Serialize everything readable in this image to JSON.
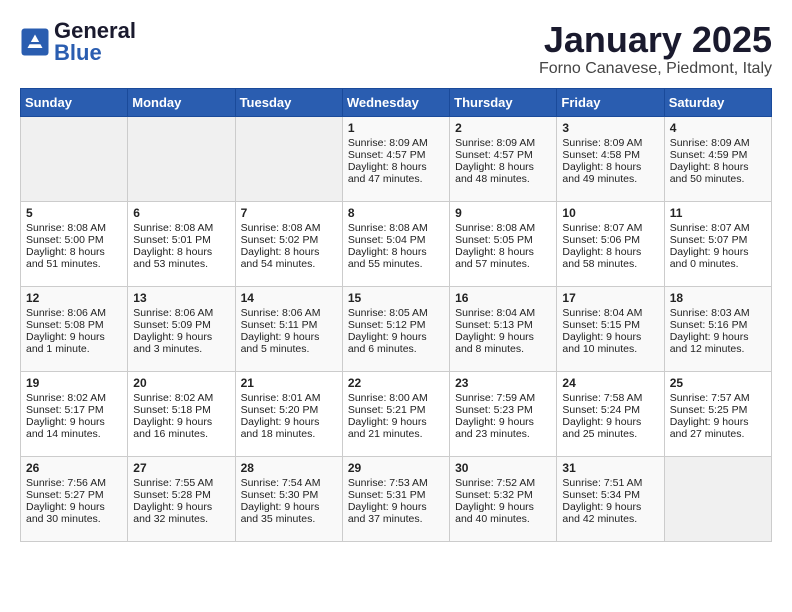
{
  "header": {
    "logo_text_general": "General",
    "logo_text_blue": "Blue",
    "title": "January 2025",
    "subtitle": "Forno Canavese, Piedmont, Italy"
  },
  "days_of_week": [
    "Sunday",
    "Monday",
    "Tuesday",
    "Wednesday",
    "Thursday",
    "Friday",
    "Saturday"
  ],
  "weeks": [
    [
      {
        "day": "",
        "info": ""
      },
      {
        "day": "",
        "info": ""
      },
      {
        "day": "",
        "info": ""
      },
      {
        "day": "1",
        "info": "Sunrise: 8:09 AM\nSunset: 4:57 PM\nDaylight: 8 hours and 47 minutes."
      },
      {
        "day": "2",
        "info": "Sunrise: 8:09 AM\nSunset: 4:57 PM\nDaylight: 8 hours and 48 minutes."
      },
      {
        "day": "3",
        "info": "Sunrise: 8:09 AM\nSunset: 4:58 PM\nDaylight: 8 hours and 49 minutes."
      },
      {
        "day": "4",
        "info": "Sunrise: 8:09 AM\nSunset: 4:59 PM\nDaylight: 8 hours and 50 minutes."
      }
    ],
    [
      {
        "day": "5",
        "info": "Sunrise: 8:08 AM\nSunset: 5:00 PM\nDaylight: 8 hours and 51 minutes."
      },
      {
        "day": "6",
        "info": "Sunrise: 8:08 AM\nSunset: 5:01 PM\nDaylight: 8 hours and 53 minutes."
      },
      {
        "day": "7",
        "info": "Sunrise: 8:08 AM\nSunset: 5:02 PM\nDaylight: 8 hours and 54 minutes."
      },
      {
        "day": "8",
        "info": "Sunrise: 8:08 AM\nSunset: 5:04 PM\nDaylight: 8 hours and 55 minutes."
      },
      {
        "day": "9",
        "info": "Sunrise: 8:08 AM\nSunset: 5:05 PM\nDaylight: 8 hours and 57 minutes."
      },
      {
        "day": "10",
        "info": "Sunrise: 8:07 AM\nSunset: 5:06 PM\nDaylight: 8 hours and 58 minutes."
      },
      {
        "day": "11",
        "info": "Sunrise: 8:07 AM\nSunset: 5:07 PM\nDaylight: 9 hours and 0 minutes."
      }
    ],
    [
      {
        "day": "12",
        "info": "Sunrise: 8:06 AM\nSunset: 5:08 PM\nDaylight: 9 hours and 1 minute."
      },
      {
        "day": "13",
        "info": "Sunrise: 8:06 AM\nSunset: 5:09 PM\nDaylight: 9 hours and 3 minutes."
      },
      {
        "day": "14",
        "info": "Sunrise: 8:06 AM\nSunset: 5:11 PM\nDaylight: 9 hours and 5 minutes."
      },
      {
        "day": "15",
        "info": "Sunrise: 8:05 AM\nSunset: 5:12 PM\nDaylight: 9 hours and 6 minutes."
      },
      {
        "day": "16",
        "info": "Sunrise: 8:04 AM\nSunset: 5:13 PM\nDaylight: 9 hours and 8 minutes."
      },
      {
        "day": "17",
        "info": "Sunrise: 8:04 AM\nSunset: 5:15 PM\nDaylight: 9 hours and 10 minutes."
      },
      {
        "day": "18",
        "info": "Sunrise: 8:03 AM\nSunset: 5:16 PM\nDaylight: 9 hours and 12 minutes."
      }
    ],
    [
      {
        "day": "19",
        "info": "Sunrise: 8:02 AM\nSunset: 5:17 PM\nDaylight: 9 hours and 14 minutes."
      },
      {
        "day": "20",
        "info": "Sunrise: 8:02 AM\nSunset: 5:18 PM\nDaylight: 9 hours and 16 minutes."
      },
      {
        "day": "21",
        "info": "Sunrise: 8:01 AM\nSunset: 5:20 PM\nDaylight: 9 hours and 18 minutes."
      },
      {
        "day": "22",
        "info": "Sunrise: 8:00 AM\nSunset: 5:21 PM\nDaylight: 9 hours and 21 minutes."
      },
      {
        "day": "23",
        "info": "Sunrise: 7:59 AM\nSunset: 5:23 PM\nDaylight: 9 hours and 23 minutes."
      },
      {
        "day": "24",
        "info": "Sunrise: 7:58 AM\nSunset: 5:24 PM\nDaylight: 9 hours and 25 minutes."
      },
      {
        "day": "25",
        "info": "Sunrise: 7:57 AM\nSunset: 5:25 PM\nDaylight: 9 hours and 27 minutes."
      }
    ],
    [
      {
        "day": "26",
        "info": "Sunrise: 7:56 AM\nSunset: 5:27 PM\nDaylight: 9 hours and 30 minutes."
      },
      {
        "day": "27",
        "info": "Sunrise: 7:55 AM\nSunset: 5:28 PM\nDaylight: 9 hours and 32 minutes."
      },
      {
        "day": "28",
        "info": "Sunrise: 7:54 AM\nSunset: 5:30 PM\nDaylight: 9 hours and 35 minutes."
      },
      {
        "day": "29",
        "info": "Sunrise: 7:53 AM\nSunset: 5:31 PM\nDaylight: 9 hours and 37 minutes."
      },
      {
        "day": "30",
        "info": "Sunrise: 7:52 AM\nSunset: 5:32 PM\nDaylight: 9 hours and 40 minutes."
      },
      {
        "day": "31",
        "info": "Sunrise: 7:51 AM\nSunset: 5:34 PM\nDaylight: 9 hours and 42 minutes."
      },
      {
        "day": "",
        "info": ""
      }
    ]
  ]
}
